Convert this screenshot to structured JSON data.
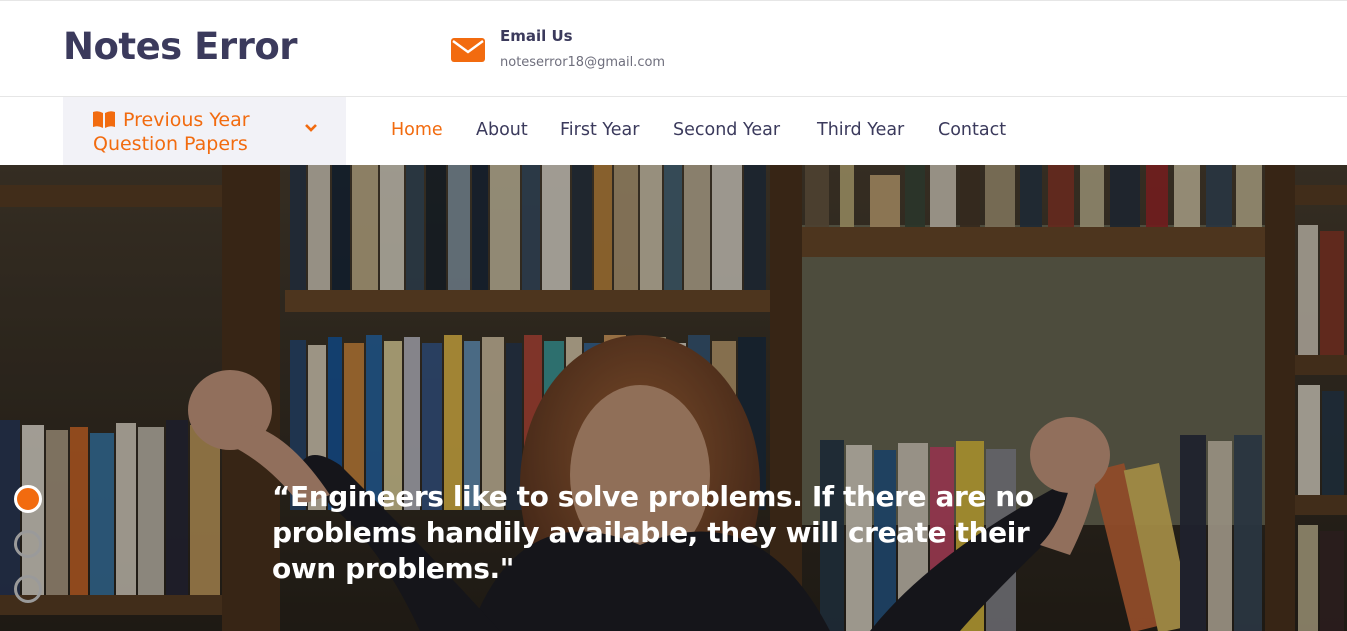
{
  "header": {
    "logo": "Notes Error",
    "email_label": "Email Us",
    "email_value": "noteserror18@gmail.com",
    "icon": "envelope-icon"
  },
  "nav": {
    "category_label": "Previous Year Question Papers",
    "category_icon": "book-icon",
    "items": [
      {
        "label": "Home",
        "active": true
      },
      {
        "label": "About",
        "active": false
      },
      {
        "label": "First Year",
        "active": false
      },
      {
        "label": "Second Year",
        "active": false
      },
      {
        "label": "Third Year",
        "active": false
      },
      {
        "label": "Contact",
        "active": false
      }
    ]
  },
  "hero": {
    "quote": "“Engineers like to solve problems. If there are no problems handily available, they will create their own problems.\"",
    "slides": 3,
    "active_slide": 0
  },
  "colors": {
    "accent": "#f26b0f",
    "text_dark": "#3b3a5c"
  }
}
